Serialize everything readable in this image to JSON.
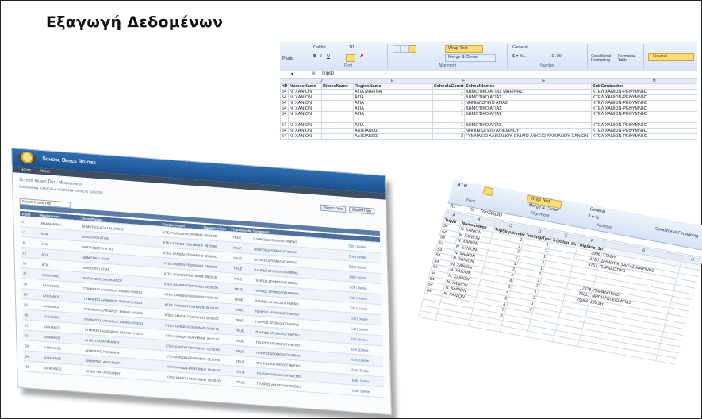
{
  "slide": {
    "title": "Εξαγωγή Δεδομένων"
  },
  "excel1": {
    "ribbon": {
      "font_name": "Calibri",
      "font_size": "10",
      "wrap_text": "Wrap Text",
      "merge_center": "Merge & Center",
      "number_format": "General",
      "conditional_formatting": "Conditional Formatting",
      "format_as_table": "Format as Table",
      "neutral": "Neutral",
      "paste": "Paste",
      "groups": [
        "Font",
        "Alignment",
        "Number"
      ]
    },
    "name_box": "",
    "formula": "TripID",
    "columns": [
      "D",
      "E",
      "F",
      "G",
      "H"
    ],
    "headers": [
      "rID",
      "NomosName",
      "DimosName",
      "RegionName",
      "SchoolsCount",
      "SchoolNames",
      "SubContractor"
    ],
    "rows": [
      [
        "54",
        "N. XANION",
        "",
        "ΑΓΙΑ ΜΑΡΙΝΑ",
        "1",
        "ΔΗΜΟΤΙΚΟ ΑΓΙΑΣ ΜΑΡΙΝΗΣ",
        "ΚΤΕΛ ΧΑΝΙΩΝ-ΡΕΘΥΜΝΗΣ"
      ],
      [
        "54",
        "N. XANION",
        "",
        "ΑΓΙΑ",
        "1",
        "ΔΗΜΟΤΙΚΟ ΑΓΙΑΣ",
        "ΚΤΕΛ ΧΑΝΙΩΝ-ΡΕΘΥΜΝΗΣ"
      ],
      [
        "54",
        "N. XANION",
        "",
        "ΑΓΙΑ",
        "1",
        "ΝΗΠΙΑΓΩΓΕΙΟ ΑΓΙΑΣ",
        "ΚΤΕΛ ΧΑΝΙΩΝ-ΡΕΘΥΜΝΗΣ"
      ],
      [
        "54",
        "N. XANION",
        "",
        "ΑΓΙΑ",
        "1",
        "ΔΗΜΟΤΙΚΟ ΑΓΙΑΣ",
        "ΚΤΕΛ ΧΑΝΙΩΝ-ΡΕΘΥΜΝΗΣ"
      ],
      [
        "54",
        "N. XANION",
        "",
        "ΑΓΙΑ",
        "1",
        "ΔΗΜΟΤΙΚΟ ΑΓΙΑΣ",
        "ΚΤΕΛ ΧΑΝΙΩΝ-ΡΕΘΥΜΝΗΣ"
      ],
      [
        "",
        "",
        "",
        "",
        "",
        "",
        ""
      ],
      [
        "54",
        "N. XANION",
        "",
        "ΑΓΙΑ",
        "1",
        "ΔΗΜΟΤΙΚΟ ΑΓΙΑΣ",
        "ΚΤΕΛ ΧΑΝΙΩΝ-ΡΕΘΥΜΝΗΣ"
      ],
      [
        "54",
        "N. XANION",
        "",
        "ΑΛΙΚΙΑΝΟΣ",
        "1",
        "ΝΗΠΙΑΓΩΓΕΙΟ ΑΛΙΚΙΑΝΟΥ",
        "ΚΤΕΛ ΧΑΝΙΩΝ-ΡΕΘΥΜΝΗΣ"
      ],
      [
        "54",
        "N. XANION",
        "",
        "ΑΛΙΚΙΑΝΟΣ",
        "2",
        "ΓΥΜΝΑΣΙΟ ΑΛΙΚΙΑΝΟΥ, ΕΝΙΑΙΟ ΛΥΚΕΙΟ ΑΛΙΚΙΑΝΟΥ ΧΑΝΙΩΝ",
        "ΚΤΕΛ ΧΑΝΙΩΝ-ΡΕΘΥΜΝΗΣ"
      ]
    ]
  },
  "webapp": {
    "app_title": "School Buses Routes",
    "nav": [
      "Home",
      "About"
    ],
    "page_title": "School Buses Data Management",
    "breadcrumb": "Prefecture ▸ XANION ▸ XANION ▸ XANION XANION",
    "buttons": [
      "Export Data",
      "Export Trips"
    ],
    "search_label": "Search Route Trip",
    "table_header": [
      "TripID",
      "RegionName",
      "SchoolNames",
      "SubContractor",
      "DepartureTime",
      "TripStatusName",
      "Comments",
      ""
    ],
    "rows": [
      [
        "5",
        "ΑΓΙΑ ΜΑΡΙΝΑ",
        "ΔΗΜΟΤΙΚΟ ΑΓΙΑΣ ΜΑΡΙΝΗΣ",
        "ΚΤΕΛ ΧΑΝΙΩΝ-ΡΕΘΥΜΝΗΣ",
        "08:00:00",
        "TRUE",
        "ΠΛΗΡΩΣ ΔΡΟΜΟΛΟΓΗΜΕΝΟ",
        "Edit | Delete"
      ],
      [
        "13",
        "ΑΓΙΑ",
        "ΔΗΜΟΤΙΚΟ ΑΓΙΑΣ",
        "ΚΤΕΛ ΧΑΝΙΩΝ-ΡΕΘΥΜΝΗΣ",
        "08:00:00",
        "TRUE",
        "ΠΛΗΡΩΣ ΔΡΟΜΟΛΟΓΗΜΕΝΟ",
        "Edit | Delete"
      ],
      [
        "15",
        "ΑΓΙΑ",
        "ΝΗΠΙΑΓΩΓΕΙΟ ΑΓΙΑΣ",
        "ΚΤΕΛ ΧΑΝΙΩΝ-ΡΕΘΥΜΝΗΣ",
        "08:00:00",
        "TRUE",
        "ΠΛΗΡΩΣ ΔΡΟΜΟΛΟΓΗΜΕΝΟ",
        "Edit | Delete"
      ],
      [
        "18",
        "ΑΓΙΑ",
        "ΔΗΜΟΤΙΚΟ ΑΓΙΑΣ",
        "ΚΤΕΛ ΧΑΝΙΩΝ-ΡΕΘΥΜΝΗΣ",
        "08:00:00",
        "TRUE",
        "ΠΛΗΡΩΣ ΔΡΟΜΟΛΟΓΗΜΕΝΟ",
        "Edit | Delete"
      ],
      [
        "19",
        "ΑΓΙΑ",
        "ΔΗΜΟΤΙΚΟ ΑΓΙΑΣ",
        "ΚΤΕΛ ΧΑΝΙΩΝ-ΡΕΘΥΜΝΗΣ",
        "08:00:00",
        "TRUE",
        "ΠΛΗΡΩΣ ΔΡΟΜΟΛΟΓΗΜΕΝΟ",
        "Edit | Delete"
      ],
      [
        "22",
        "ΑΛΙΚΙΑΝΟΣ",
        "ΝΗΠΙΑΓΩΓΕΙΟ ΑΛΙΚΙΑΝΟΥ",
        "ΚΤΕΛ ΧΑΝΙΩΝ-ΡΕΘΥΜΝΗΣ",
        "08:00:00",
        "TRUE",
        "ΠΛΗΡΩΣ ΔΡΟΜΟΛΟΓΗΜΕΝΟ",
        "Edit | Delete"
      ],
      [
        "24",
        "ΑΛΙΚΙΑΝΟΣ",
        "ΓΥΜΝΑΣΙΟ ΑΛΙΚΙΑΝΟΥ, ΕΝΙΑΙΟ ΛΥΚΕΙΟ",
        "ΚΤΕΛ ΧΑΝΙΩΝ-ΡΕΘΥΜΝΗΣ",
        "08:00:00",
        "TRUE",
        "ΠΛΗΡΩΣ ΔΡΟΜΟΛΟΓΗΜΕΝΟ",
        "Edit | Delete"
      ],
      [
        "26",
        "ΑΛΙΚΙΑΝΟΣ",
        "ΓΥΜΝΑΣΙΟ ΑΛΙΚΙΑΝΟΥ, ΕΝΙΑΙΟ ΛΥΚΕΙΟ",
        "ΚΤΕΛ ΧΑΝΙΩΝ-ΡΕΘΥΜΝΗΣ",
        "08:00:00",
        "TRUE",
        "ΠΛΗΡΩΣ ΔΡΟΜΟΛΟΓΗΜΕΝΟ",
        "Edit | Delete"
      ],
      [
        "28",
        "ΑΛΙΚΙΑΝΟΣ",
        "ΓΥΜΝΑΣΙΟ ΑΛΙΚΙΑΝΟΥ, ΕΝΙΑΙΟ ΛΥΚΕΙΟ",
        "ΚΤΕΛ ΧΑΝΙΩΝ-ΡΕΘΥΜΝΗΣ",
        "08:00:00",
        "TRUE",
        "ΠΛΗΡΩΣ ΔΡΟΜΟΛΟΓΗΜΕΝΟ",
        "Edit | Delete"
      ],
      [
        "30",
        "ΑΛΙΚΙΑΝΟΣ",
        "ΓΥΜΝΑΣΙΟ ΑΛΙΚΙΑΝΟΥ, ΕΝΙΑΙΟ ΛΥΚΕΙΟ",
        "ΚΤΕΛ ΧΑΝΙΩΝ-ΡΕΘΥΜΝΗΣ",
        "08:00:00",
        "TRUE",
        "ΠΛΗΡΩΣ ΔΡΟΜΟΛΟΓΗΜΕΝΟ",
        "Edit | Delete"
      ],
      [
        "31",
        "ΑΛΙΚΙΑΝΟΣ",
        "ΓΥΜΝΑΣΙΟ ΑΛΙΚΙΑΝΟΥ, ΕΝΙΑΙΟ ΛΥΚΕΙΟ",
        "ΚΤΕΛ ΧΑΝΙΩΝ-ΡΕΘΥΜΝΗΣ",
        "08:00:00",
        "TRUE",
        "ΠΛΗΡΩΣ ΔΡΟΜΟΛΟΓΗΜΕΝΟ",
        "Edit | Delete"
      ],
      [
        "32",
        "ΑΛΙΚΙΑΝΟΣ",
        "ΔΗΜΟΤΙΚΟ ΑΛΙΚΙΑΝΟΥ",
        "ΚΤΕΛ ΧΑΝΙΩΝ-ΡΕΘΥΜΝΗΣ",
        "08:00:00",
        "TRUE",
        "ΠΛΗΡΩΣ ΔΡΟΜΟΛΟΓΗΜΕΝΟ",
        "Edit | Delete"
      ],
      [
        "33",
        "ΑΛΙΚΙΑΝΟΣ",
        "ΔΗΜΟΤΙΚΟ ΑΛΙΚΙΑΝΟΥ",
        "ΚΤΕΛ ΧΑΝΙΩΝ-ΡΕΘΥΜΝΗΣ",
        "08:00:00",
        "TRUE",
        "ΠΛΗΡΩΣ ΔΡΟΜΟΛΟΓΗΜΕΝΟ",
        "Edit | Delete"
      ],
      [
        "34",
        "ΑΛΙΚΙΑΝΟΣ",
        "ΔΗΜΟΤΙΚΟ ΑΛΙΚΙΑΝΟΥ",
        "ΚΤΕΛ ΧΑΝΙΩΝ-ΡΕΘΥΜΝΗΣ",
        "08:00:00",
        "TRUE",
        "ΠΛΗΡΩΣ ΔΡΟΜΟΛΟΓΗΜΕΝΟ",
        "Edit | Delete"
      ],
      [
        "36",
        "ΑΛΙΚΙΑΝΟΣ",
        "ΔΗΜΟΤΙΚΟ ΑΛΙΚΙΑΝΟΥ",
        "ΚΤΕΛ ΧΑΝΙΩΝ-ΡΕΘΥΜΝΗΣ",
        "08:00:00",
        "TRUE",
        "ΠΛΗΡΩΣ ΔΡΟΜΟΛΟΓΗΜΕΝΟ",
        "Edit | Delete"
      ]
    ]
  },
  "excel2": {
    "ribbon": {
      "font": "Font",
      "wrap_text": "Wrap Text",
      "merge_center": "Merge & Center",
      "number_format": "General",
      "alignment": "Alignment",
      "number": "Number",
      "conditional": "Conditional Formatting"
    },
    "name_box": "A1",
    "formula": "TripStopID",
    "columns": [
      "A",
      "B",
      "C",
      "D",
      "E",
      "F",
      "G",
      "H"
    ],
    "headers": [
      "TripID",
      "NomosName",
      "TripStopNumber",
      "TripStopType",
      "TripStop_Direction",
      "TripStop_StopName",
      "",
      ""
    ],
    "rows": [
      [
        "54",
        "N. XANION",
        "1",
        "1",
        "",
        "2996",
        "ΣΤΑΣΗ",
        ""
      ],
      [
        "54",
        "N. XANION",
        "1",
        "2",
        "",
        "3790",
        "ΔΗΜΟΤΙΚΟ ΑΓΙΑΣ ΜΑΡΙΝΗΣ",
        ""
      ],
      [
        "54",
        "N. XANION",
        "2",
        "1",
        "",
        "3757",
        "ΠΑΡΑΔΟΤΙΚΟ",
        ""
      ],
      [
        "54",
        "N. XANION",
        "2",
        "2",
        "",
        "",
        "",
        ""
      ],
      [
        "54",
        "N. XANION",
        "3",
        "1",
        "",
        "",
        "",
        ""
      ],
      [
        "54",
        "N. XANION",
        "3",
        "2",
        "",
        "",
        "",
        ""
      ],
      [
        "54",
        "N. XANION",
        "4",
        "1",
        "",
        "17578",
        "ΠΑΡΑΔΟΤΙΚΟ",
        ""
      ],
      [
        "54",
        "N. XANION",
        "4",
        "2",
        "",
        "33213",
        "ΝΗΠΙΑΓΩΓΕΙΟ ΑΓΙΑΣ",
        ""
      ],
      [
        "54",
        "N. XANION",
        "5",
        "1",
        "",
        "29966",
        "ΣΤΑΣΗ",
        ""
      ],
      [
        "54",
        "N. XANION",
        "5",
        "2",
        "",
        "",
        "",
        ""
      ],
      [
        "54",
        "N. XANION",
        "6",
        "1",
        "",
        "",
        "",
        ""
      ],
      [
        "54",
        "N. XANION",
        "6",
        "2",
        "",
        "",
        "",
        ""
      ],
      [
        "",
        "",
        "7",
        "",
        "",
        "",
        "",
        ""
      ],
      [
        "",
        "",
        "8",
        "",
        "",
        "",
        "",
        ""
      ],
      [
        "",
        "",
        "",
        "",
        "",
        "",
        "",
        ""
      ],
      [
        "",
        "",
        "",
        "",
        "",
        "",
        "",
        ""
      ]
    ]
  },
  "colors": {
    "web_header": "#1c4f8c",
    "web_nav": "#3e4e63",
    "excel_ribbon": "#d7e3f4",
    "excel_highlight": "#f7dc7a"
  }
}
